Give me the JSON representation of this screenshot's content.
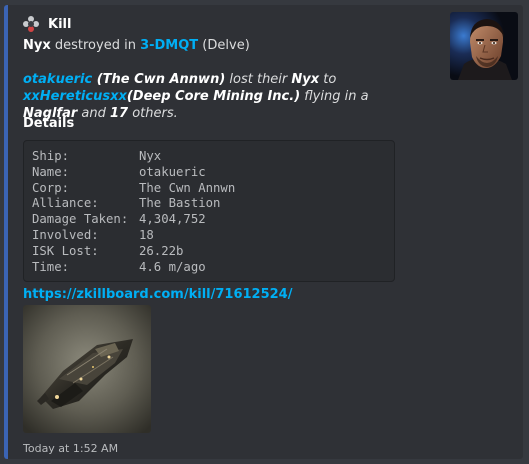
{
  "author": {
    "name": "Kill",
    "icon": "target-icon"
  },
  "title": {
    "victim_ship": "Nyx",
    "verb": " destroyed in ",
    "system": "3-DMQT",
    "region": " (Delve)"
  },
  "description": {
    "victim": "otakueric",
    "victim_corp": " (The Cwn Annwn)",
    "text1": " lost their ",
    "ship": "Nyx",
    "text2": " to ",
    "attacker": "xxHereticusxx",
    "attacker_corp": "(Deep Core Mining Inc.)",
    "text3": " flying in a ",
    "attacker_ship": "Naglfar",
    "text4": " and ",
    "others_count": "17",
    "text5": " others."
  },
  "details": {
    "heading": "Details",
    "rows": [
      {
        "key": "Ship:",
        "value": "Nyx"
      },
      {
        "key": "Name:",
        "value": "otakueric"
      },
      {
        "key": "Corp:",
        "value": "The Cwn Annwn"
      },
      {
        "key": "Alliance:",
        "value": "The Bastion"
      },
      {
        "key": "Damage Taken:",
        "value": "4,304,752"
      },
      {
        "key": "Involved:",
        "value": "18"
      },
      {
        "key": "ISK Lost:",
        "value": "26.22b"
      },
      {
        "key": "Time:",
        "value": "4.6 m/ago"
      }
    ]
  },
  "link": "https://zkillboard.com/kill/71612524/",
  "timestamp": "Today at 1:52 AM",
  "colors": {
    "background": "#36393f",
    "embed": "#2f3136",
    "accent_bar": "#3b64b5",
    "link": "#00aff4"
  }
}
